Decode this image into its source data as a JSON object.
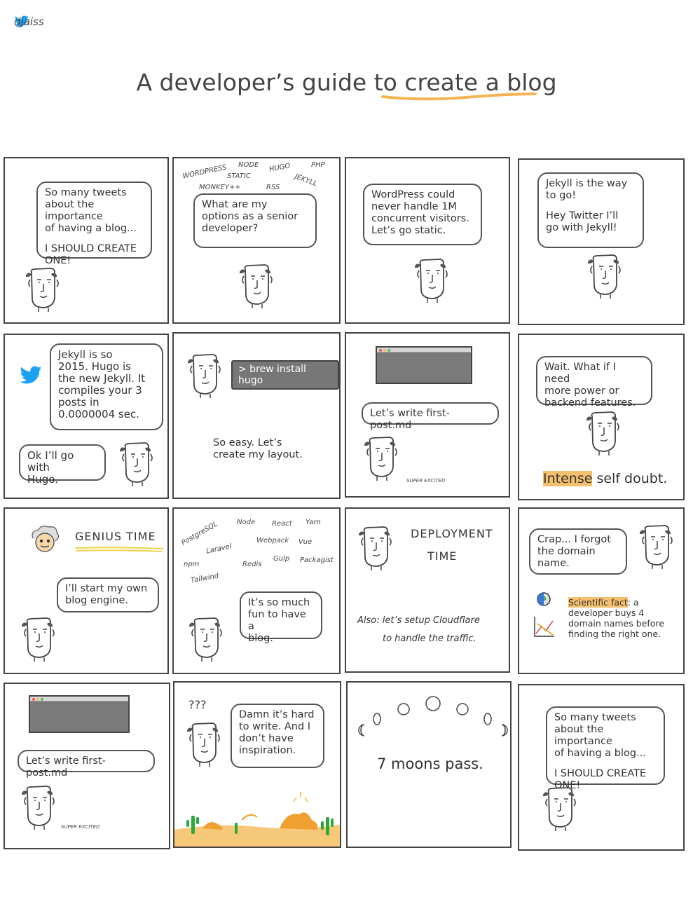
{
  "header": {
    "handle": "djaiss",
    "title_prefix": "A developer’s guide to ",
    "title_highlight": "create a blog",
    "accent": "#f5b454"
  },
  "panels": {
    "p1": {
      "lines": [
        "So many tweets",
        "about the importance",
        "of having a blog..."
      ],
      "shout": [
        "I SHOULD CREATE",
        "ONE!"
      ]
    },
    "p2": {
      "scribbles": [
        "WORDPRESS",
        "NODE",
        "STATIC",
        "HUGO",
        "PHP",
        "MONKEY++",
        "RSS",
        "JEKYLL"
      ],
      "lines": [
        "What are my",
        "options as a senior",
        "developer?"
      ]
    },
    "p3": {
      "lines": [
        "WordPress could",
        "never handle 1M",
        "concurrent visitors.",
        "Let’s go static."
      ]
    },
    "p4": {
      "lines1": [
        "Jekyll is the way",
        "to go!"
      ],
      "lines2": [
        "Hey Twitter I’ll",
        "go with Jekyll!"
      ]
    },
    "p5": {
      "lines": [
        "Jekyll is so",
        "2015. Hugo is",
        "the new Jekyll. It",
        "compiles your 3",
        "posts in",
        "0.0000004 sec."
      ],
      "reply": [
        "Ok I’ll go with",
        "Hugo."
      ]
    },
    "p6": {
      "command": "> brew install hugo",
      "lines": [
        "So easy. Let’s",
        "create my layout."
      ]
    },
    "p7": {
      "lines": [
        "Let’s write first-post.md"
      ],
      "caption": "SUPER EXCITED"
    },
    "p8": {
      "lines": [
        "Wait. What if I need",
        "more power or",
        "backend features."
      ],
      "emph": "Intense",
      "rest": " self doubt."
    },
    "p9": {
      "label": "GENIUS TIME",
      "lines": [
        "I’ll start my own",
        "blog engine."
      ]
    },
    "p10": {
      "scribbles": [
        "PostgreSQL",
        "Node",
        "React",
        "Yarn",
        "Laravel",
        "Webpack",
        "Vue",
        "npm",
        "Redis",
        "Gulp",
        "Packagist",
        "Tailwind"
      ],
      "lines": [
        "It’s so much",
        "fun to have a",
        "blog."
      ]
    },
    "p11": {
      "label1": "DEPLOYMENT",
      "label2": "TIME",
      "note1": "Also: let’s setup Cloudflare",
      "note2": "to handle the traffic."
    },
    "p12": {
      "lines": [
        "Crap... I forgot",
        "the domain",
        "name."
      ],
      "fact_label": "Scientific fact",
      "fact_rest": ": a",
      "fact_lines": [
        "developer buys 4",
        "domain names before",
        "finding the right one."
      ]
    },
    "p13": {
      "lines": [
        "Let’s write first-post.md"
      ],
      "caption": "SUPER EXCITED"
    },
    "p14": {
      "marks": "???",
      "lines": [
        "Damn it’s hard",
        "to write. And I",
        "don’t have",
        "inspiration."
      ]
    },
    "p15": {
      "text": "7 moons pass."
    },
    "p16": {
      "lines": [
        "So many tweets",
        "about the importance",
        "of having a blog..."
      ],
      "shout": [
        "I SHOULD CREATE",
        "ONE!"
      ]
    }
  },
  "colors": {
    "twitter": "#1da1f2",
    "cactus": "#2fa83a",
    "sand": "#f6c879",
    "highlight": "#f5c06e"
  }
}
